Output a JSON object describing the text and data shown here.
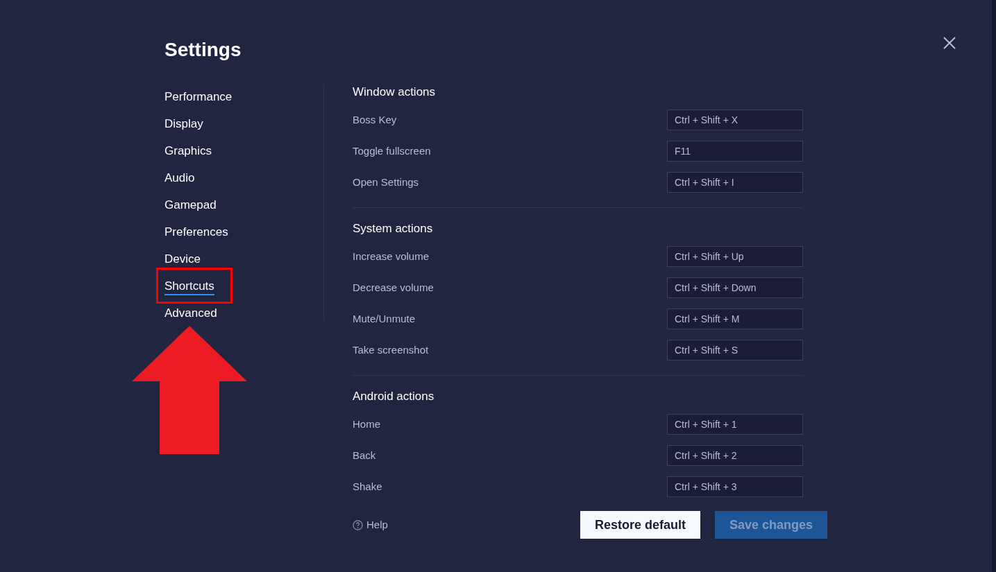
{
  "dialog": {
    "title": "Settings"
  },
  "sidebar": {
    "items": [
      {
        "label": "Performance",
        "selected": false
      },
      {
        "label": "Display",
        "selected": false
      },
      {
        "label": "Graphics",
        "selected": false
      },
      {
        "label": "Audio",
        "selected": false
      },
      {
        "label": "Gamepad",
        "selected": false
      },
      {
        "label": "Preferences",
        "selected": false
      },
      {
        "label": "Device",
        "selected": false
      },
      {
        "label": "Shortcuts",
        "selected": true
      },
      {
        "label": "Advanced",
        "selected": false
      }
    ]
  },
  "sections": [
    {
      "title": "Window actions",
      "rows": [
        {
          "label": "Boss Key",
          "shortcut": "Ctrl + Shift + X"
        },
        {
          "label": "Toggle fullscreen",
          "shortcut": "F11"
        },
        {
          "label": "Open Settings",
          "shortcut": "Ctrl + Shift + I"
        }
      ]
    },
    {
      "title": "System actions",
      "rows": [
        {
          "label": "Increase volume",
          "shortcut": "Ctrl + Shift + Up"
        },
        {
          "label": "Decrease volume",
          "shortcut": "Ctrl + Shift + Down"
        },
        {
          "label": "Mute/Unmute",
          "shortcut": "Ctrl + Shift + M"
        },
        {
          "label": "Take screenshot",
          "shortcut": "Ctrl + Shift + S"
        }
      ]
    },
    {
      "title": "Android actions",
      "rows": [
        {
          "label": "Home",
          "shortcut": "Ctrl + Shift + 1"
        },
        {
          "label": "Back",
          "shortcut": "Ctrl + Shift + 2"
        },
        {
          "label": "Shake",
          "shortcut": "Ctrl + Shift + 3"
        }
      ]
    }
  ],
  "footer": {
    "help": "Help",
    "buttons": [
      {
        "label": "Restore default",
        "kind": "secondary",
        "disabled": false
      },
      {
        "label": "Save changes",
        "kind": "primary",
        "disabled": true
      }
    ]
  }
}
